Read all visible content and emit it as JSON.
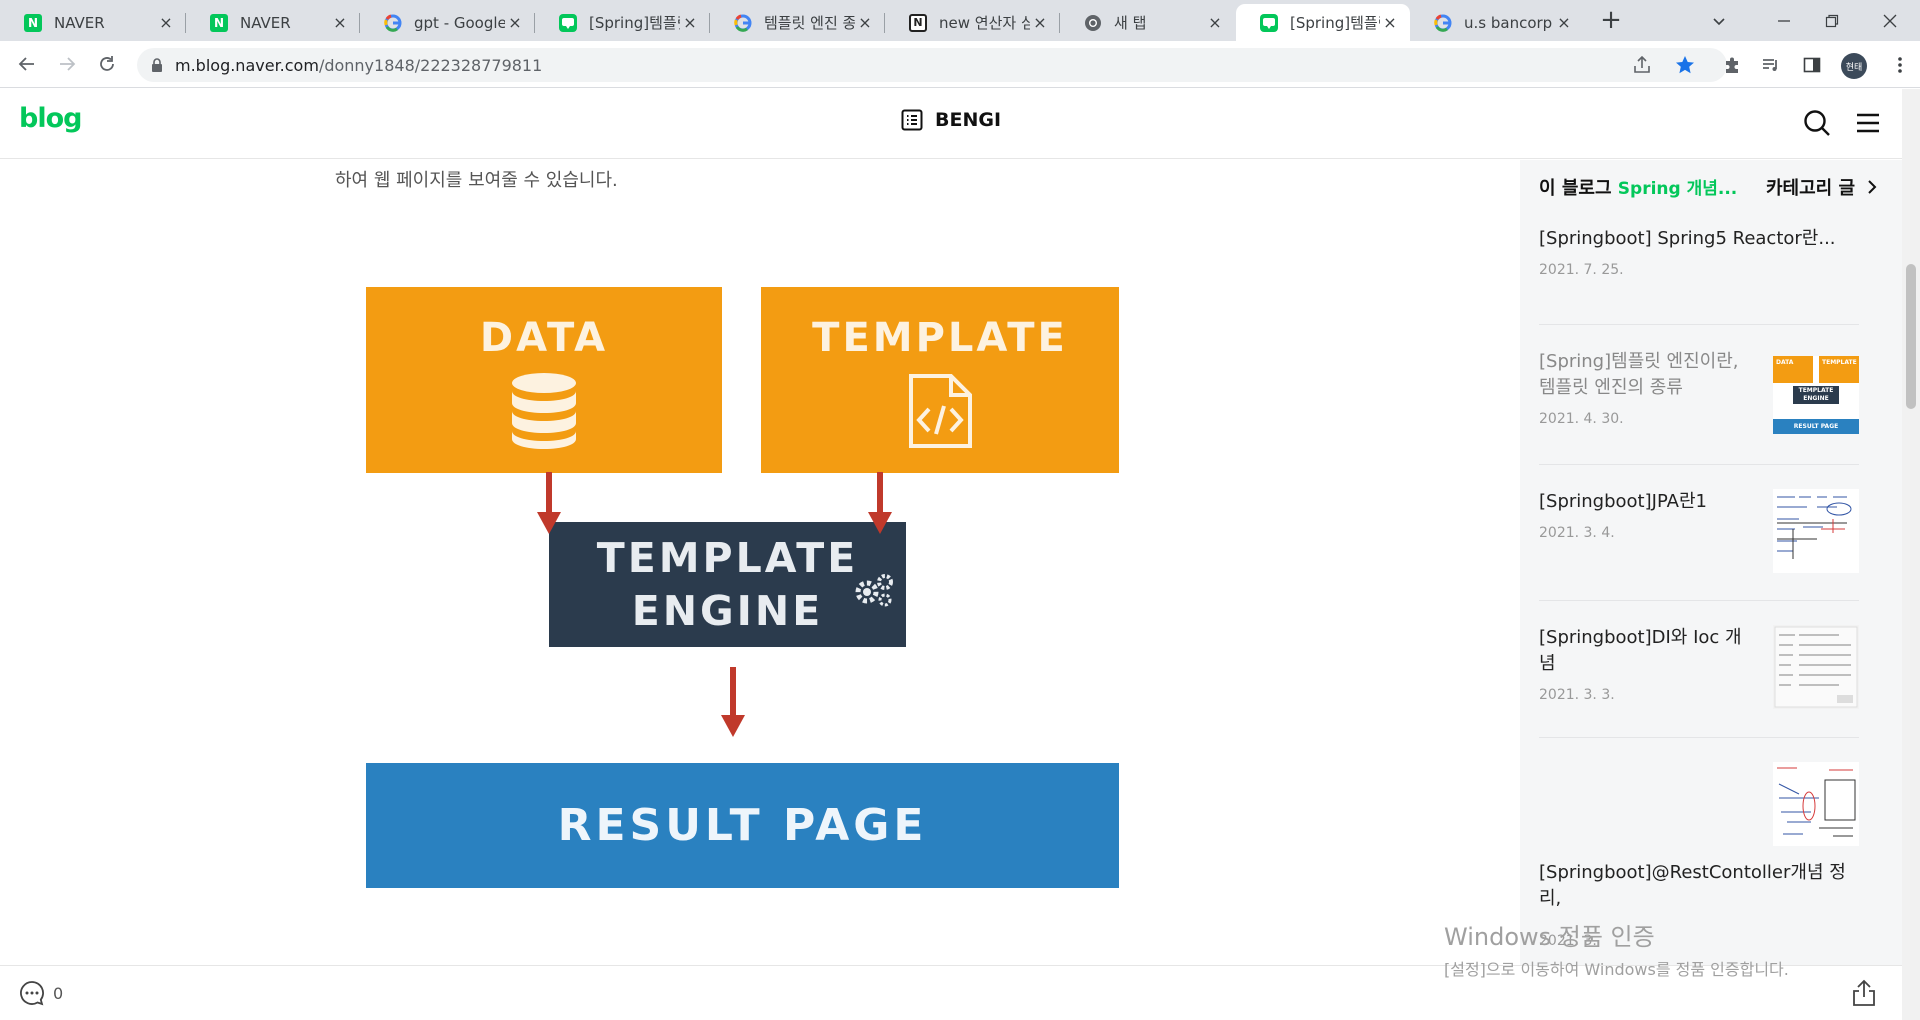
{
  "browser": {
    "tabs": [
      {
        "title": "NAVER",
        "favicon": "naver-icon"
      },
      {
        "title": "NAVER",
        "favicon": "naver-icon"
      },
      {
        "title": "gpt - Google",
        "favicon": "google-icon"
      },
      {
        "title": "[Spring]템플릿",
        "favicon": "naver-blog-icon"
      },
      {
        "title": "템플릿 엔진 종",
        "favicon": "google-icon"
      },
      {
        "title": "new 연산자 심",
        "favicon": "notion-icon"
      },
      {
        "title": "새 탭",
        "favicon": "chrome-icon"
      },
      {
        "title": "[Spring]템플릿",
        "favicon": "naver-blog-icon",
        "active": true
      },
      {
        "title": "u.s bancorp s",
        "favicon": "google-icon"
      }
    ],
    "tab_close": "×",
    "new_tab": "+",
    "url_host": "m.blog.naver.com",
    "url_path": "/donny1848/222328779811",
    "profile_label": "현태"
  },
  "blog": {
    "logo": "blog",
    "name": "BENGI"
  },
  "content": {
    "intro_text": "하여 웹 페이지를 보여줄 수 있습니다.",
    "diagram": {
      "data_label": "DATA",
      "template_label": "TEMPLATE",
      "engine_line1": "TEMPLATE",
      "engine_line2": "ENGINE",
      "result_label": "RESULT PAGE",
      "orange": "#f39c12",
      "navy": "#2b3b4d",
      "blue": "#2a81c0",
      "arrow": "#c0392b"
    }
  },
  "sidebar": {
    "prefix": "이 블로그",
    "category": "Spring 개념...",
    "category_link": "카테고리 글",
    "posts": [
      {
        "title": "[Springboot] Spring5 Reactor란...",
        "date": "2021. 7. 25."
      },
      {
        "title": "[Spring]템플릿 엔진이란, 템플릿 엔진의 종류",
        "date": "2021. 4. 30.",
        "current": true
      },
      {
        "title": "[Springboot]JPA란1",
        "date": "2021. 3. 4."
      },
      {
        "title": "[Springboot]DI와 Ioc 개념",
        "date": "2021. 3. 3."
      },
      {
        "title": "[Springboot]@RestContoller개념 정리,",
        "date": "2021. 3."
      }
    ],
    "thumb_data": "DATA",
    "thumb_template": "TEMPLATE",
    "thumb_engine": "TEMPLATE ENGINE",
    "thumb_result": "RESULT PAGE"
  },
  "footer": {
    "comment_count": "0"
  },
  "watermark": {
    "line1": "Windows 정품 인증",
    "line2": "[설정]으로 이동하여 Windows를 정품 인증합니다."
  }
}
